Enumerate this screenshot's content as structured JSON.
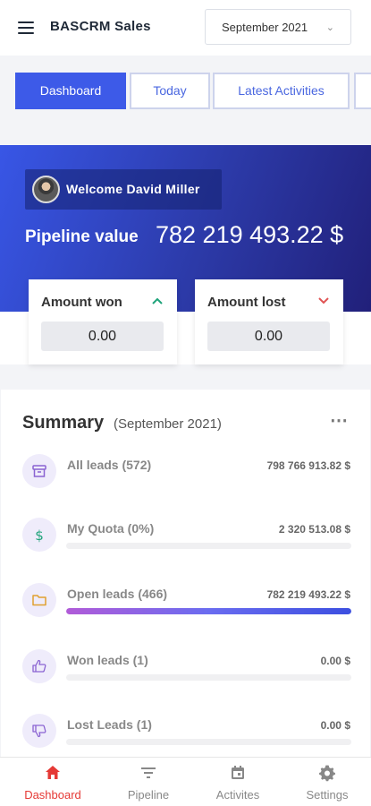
{
  "header": {
    "title": "BASCRM Sales",
    "month": "September 2021",
    "menu_icon": "hamburger-icon",
    "dropdown_icon": "chevron-down-icon"
  },
  "tabs": [
    {
      "label": "Dashboard",
      "active": true
    },
    {
      "label": "Today",
      "active": false
    },
    {
      "label": "Latest Activities",
      "active": false
    }
  ],
  "hero": {
    "welcome": "Welcome David Miller",
    "pipeline_label": "Pipeline value",
    "pipeline_value": "782 219 493.22 $",
    "amount_won": {
      "title": "Amount won",
      "value": "0.00",
      "trend_icon": "chevron-up-icon"
    },
    "amount_lost": {
      "title": "Amount lost",
      "value": "0.00",
      "trend_icon": "chevron-down-icon"
    }
  },
  "summary": {
    "title": "Summary",
    "period": "(September 2021)",
    "items": [
      {
        "label": "All leads (572)",
        "value": "798 766 913.82 $",
        "icon": "archive-icon",
        "progress": null
      },
      {
        "label": "My Quota (0%)",
        "value": "2 320 513.08 $",
        "icon": "dollar-icon",
        "progress": 0
      },
      {
        "label": "Open leads (466)",
        "value": "782 219 493.22 $",
        "icon": "folder-icon",
        "progress": 1.0
      },
      {
        "label": "Won leads (1)",
        "value": "0.00 $",
        "icon": "thumbs-up-icon",
        "progress": 0
      },
      {
        "label": "Lost Leads (1)",
        "value": "0.00 $",
        "icon": "thumbs-down-icon",
        "progress": 0
      }
    ]
  },
  "bottom_nav": [
    {
      "label": "Dashboard",
      "icon": "home-icon",
      "active": true
    },
    {
      "label": "Pipeline",
      "icon": "filter-icon",
      "active": false
    },
    {
      "label": "Activites",
      "icon": "calendar-icon",
      "active": false
    },
    {
      "label": "Settings",
      "icon": "gear-icon",
      "active": false
    }
  ],
  "colors": {
    "accent": "#3d5ae8",
    "active_nav": "#e53935",
    "won_arrow": "#1fa37a",
    "lost_arrow": "#e05454"
  }
}
